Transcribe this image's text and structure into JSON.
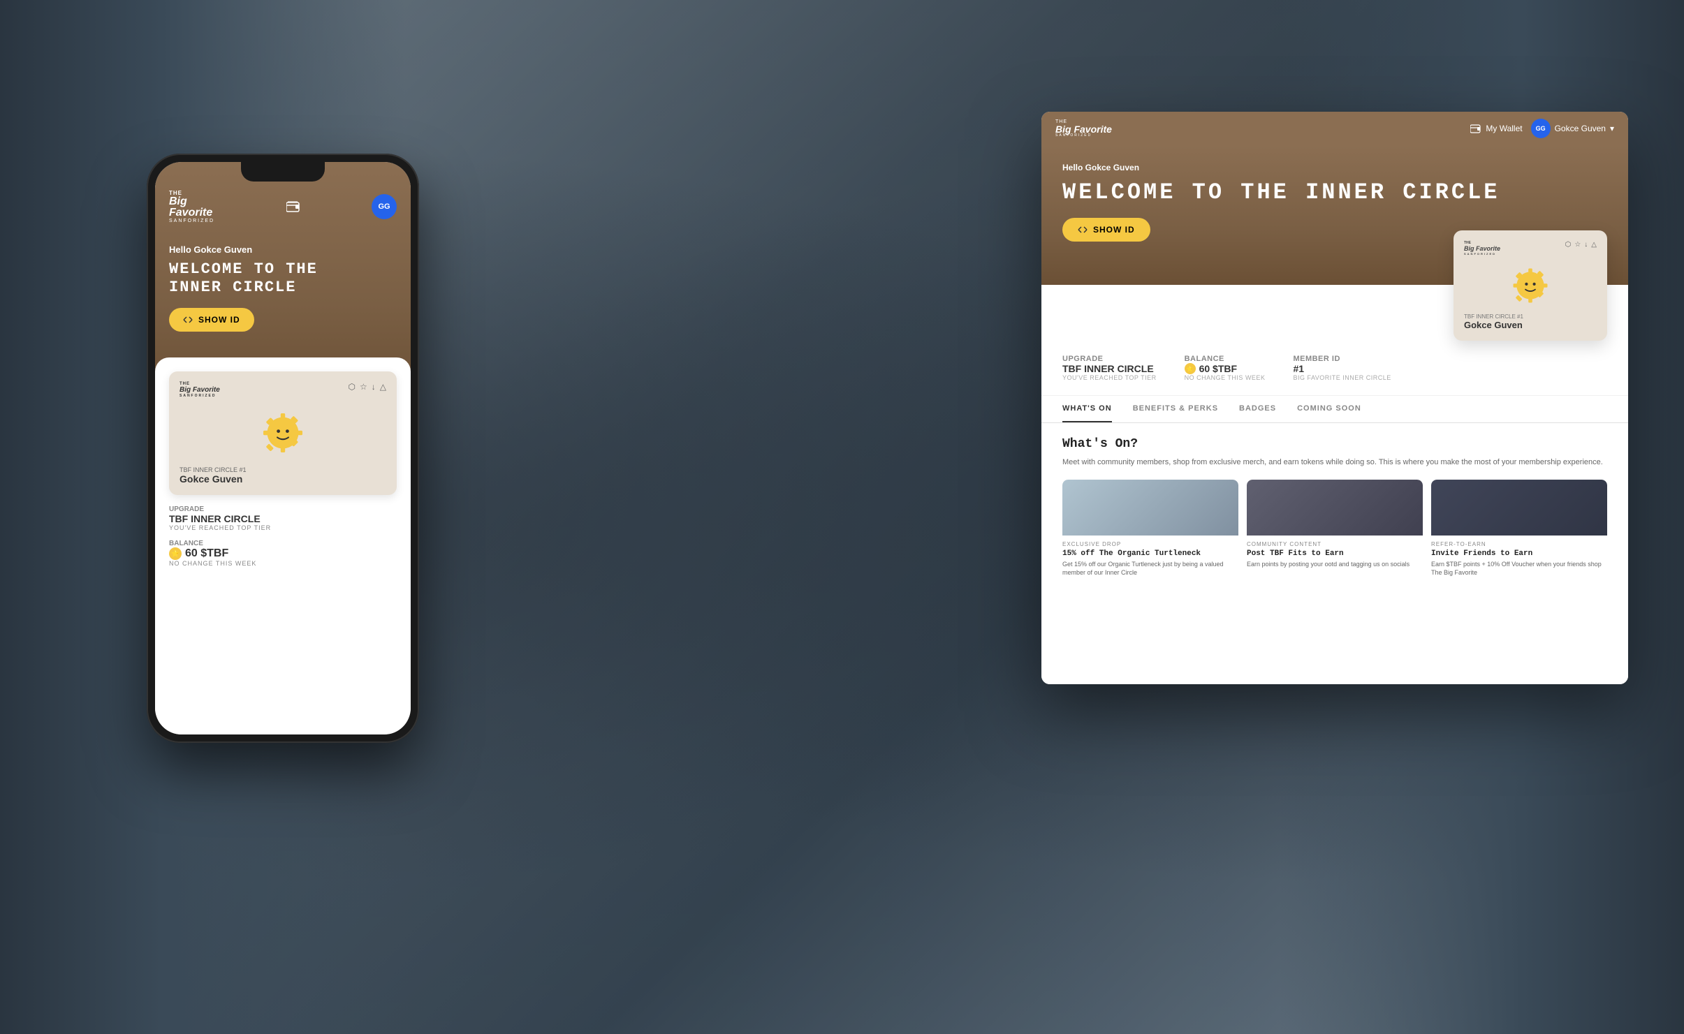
{
  "page": {
    "background_color": "#5a6b7a"
  },
  "phone": {
    "nav": {
      "logo_the": "THE",
      "logo_big": "Big",
      "logo_favorite": "Favorite",
      "logo_sanforized": "SANFORIZED",
      "avatar_initials": "GG"
    },
    "hero": {
      "hello_text": "Hello ",
      "hello_name": "Gokce Guven",
      "welcome_line1": "WELCOME TO THE",
      "welcome_line2": "INNER CIRCLE",
      "show_id_label": "SHOW ID"
    },
    "card": {
      "tier_label": "TBF INNER CIRCLE #1",
      "name": "Gokce Guven",
      "icon_share": "□",
      "icon_star": "☆",
      "icon_download": "↓",
      "icon_warning": "△"
    },
    "upgrade": {
      "label": "Upgrade",
      "title": "TBF INNER CIRCLE",
      "subtitle": "YOU'VE REACHED TOP TIER"
    },
    "balance": {
      "label": "Balance",
      "value": "60 $TBF",
      "change": "NO CHANGE THIS WEEK"
    }
  },
  "desktop": {
    "nav": {
      "logo_the": "THE",
      "logo_big": "Big",
      "logo_favorite": "Favorite",
      "logo_sanforized": "SANFORIZED",
      "wallet_label": "My Wallet",
      "user_label": "Gokce Guven",
      "user_initials": "GG"
    },
    "hero": {
      "hello_text": "Hello ",
      "hello_name": "Gokce Guven",
      "welcome_text": "WELCOME TO THE INNER CIRCLE",
      "show_id_label": "SHOW ID"
    },
    "card": {
      "logo_the": "THE",
      "logo_big": "Big Favorite",
      "logo_san": "SANFORIZED",
      "tier_label": "TBF INNER CIRCLE #1",
      "name": "Gokce Guven"
    },
    "stats": {
      "upgrade_label": "Upgrade",
      "upgrade_title": "TBF INNER CIRCLE",
      "upgrade_sub": "YOU'VE REACHED TOP TIER",
      "balance_label": "Balance",
      "balance_value": "60 $TBF",
      "balance_change": "NO CHANGE THIS WEEK",
      "member_label": "Member ID",
      "member_value": "#1",
      "member_sub": "BIG FAVORITE INNER CIRCLE"
    },
    "tabs": [
      {
        "label": "WHAT'S ON",
        "active": true
      },
      {
        "label": "BENEFITS & PERKS",
        "active": false
      },
      {
        "label": "BADGES",
        "active": false
      },
      {
        "label": "COMING SOON",
        "badge": true,
        "active": false
      }
    ],
    "whats_on": {
      "title": "What's On?",
      "description": "Meet with community members, shop from exclusive merch, and earn tokens while doing so. This is where you make the most of your membership experience.",
      "cards": [
        {
          "tag": "EXCLUSIVE DROP",
          "title": "15% off The Organic Turtleneck",
          "description": "Get 15% off our Organic Turtleneck just by being a valued member of our Inner Circle"
        },
        {
          "tag": "COMMUNITY CONTENT",
          "title": "Post TBF Fits to Earn",
          "description": "Earn points by posting your ootd and tagging us on socials"
        },
        {
          "tag": "REFER-TO-EARN",
          "title": "Invite Friends to Earn",
          "description": "Earn $TBF points + 10% Off Voucher when your friends shop The Big Favorite"
        }
      ]
    }
  }
}
